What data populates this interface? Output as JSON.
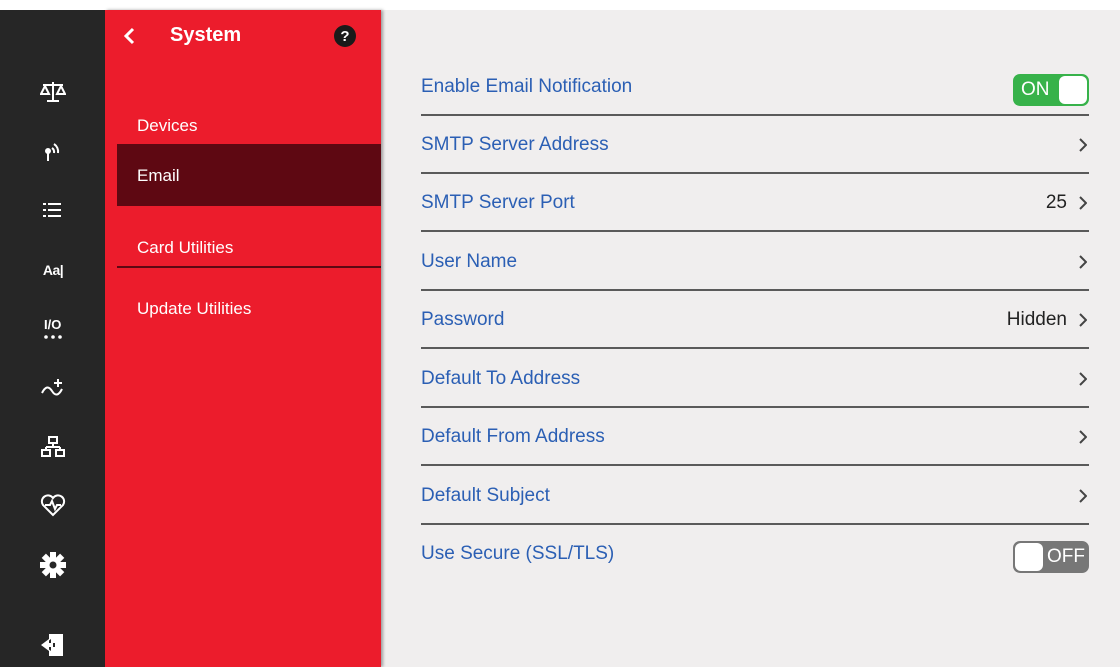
{
  "colors": {
    "rail_bg": "#262626",
    "menu_bg": "#ec1c2c",
    "menu_active": "#5e0812",
    "content_bg": "#f0eeee",
    "label_color": "#2b5fb4",
    "toggle_on": "#37b24a",
    "toggle_off": "#777777"
  },
  "rail": {
    "items": [
      {
        "icon": "scale-icon"
      },
      {
        "icon": "wireless-signal-icon"
      },
      {
        "icon": "list-icon"
      },
      {
        "icon": "font-icon",
        "text": "Aa|"
      },
      {
        "icon": "io-icon"
      },
      {
        "icon": "transfer-wave-icon"
      },
      {
        "icon": "network-icon"
      },
      {
        "icon": "heart-health-icon"
      },
      {
        "icon": "gear-icon"
      },
      {
        "icon": "logout-icon"
      }
    ]
  },
  "menu": {
    "title": "System",
    "back_icon": "chevron-left-icon",
    "help_icon": "help-circle-icon",
    "items": [
      {
        "label": "Devices",
        "active": false
      },
      {
        "label": "Email",
        "active": true
      },
      {
        "label": "Card Utilities",
        "active": false
      },
      {
        "label": "Update Utilities",
        "active": false
      }
    ]
  },
  "settings": {
    "rows": [
      {
        "label": "Enable Email Notification",
        "type": "toggle",
        "state": "ON"
      },
      {
        "label": "SMTP Server Address",
        "type": "nav",
        "value": ""
      },
      {
        "label": "SMTP Server Port",
        "type": "nav",
        "value": "25"
      },
      {
        "label": "User Name",
        "type": "nav",
        "value": ""
      },
      {
        "label": "Password",
        "type": "nav",
        "value": "Hidden"
      },
      {
        "label": "Default To Address",
        "type": "nav",
        "value": ""
      },
      {
        "label": "Default From Address",
        "type": "nav",
        "value": ""
      },
      {
        "label": "Default Subject",
        "type": "nav",
        "value": ""
      },
      {
        "label": "Use Secure (SSL/TLS)",
        "type": "toggle",
        "state": "OFF"
      }
    ]
  }
}
